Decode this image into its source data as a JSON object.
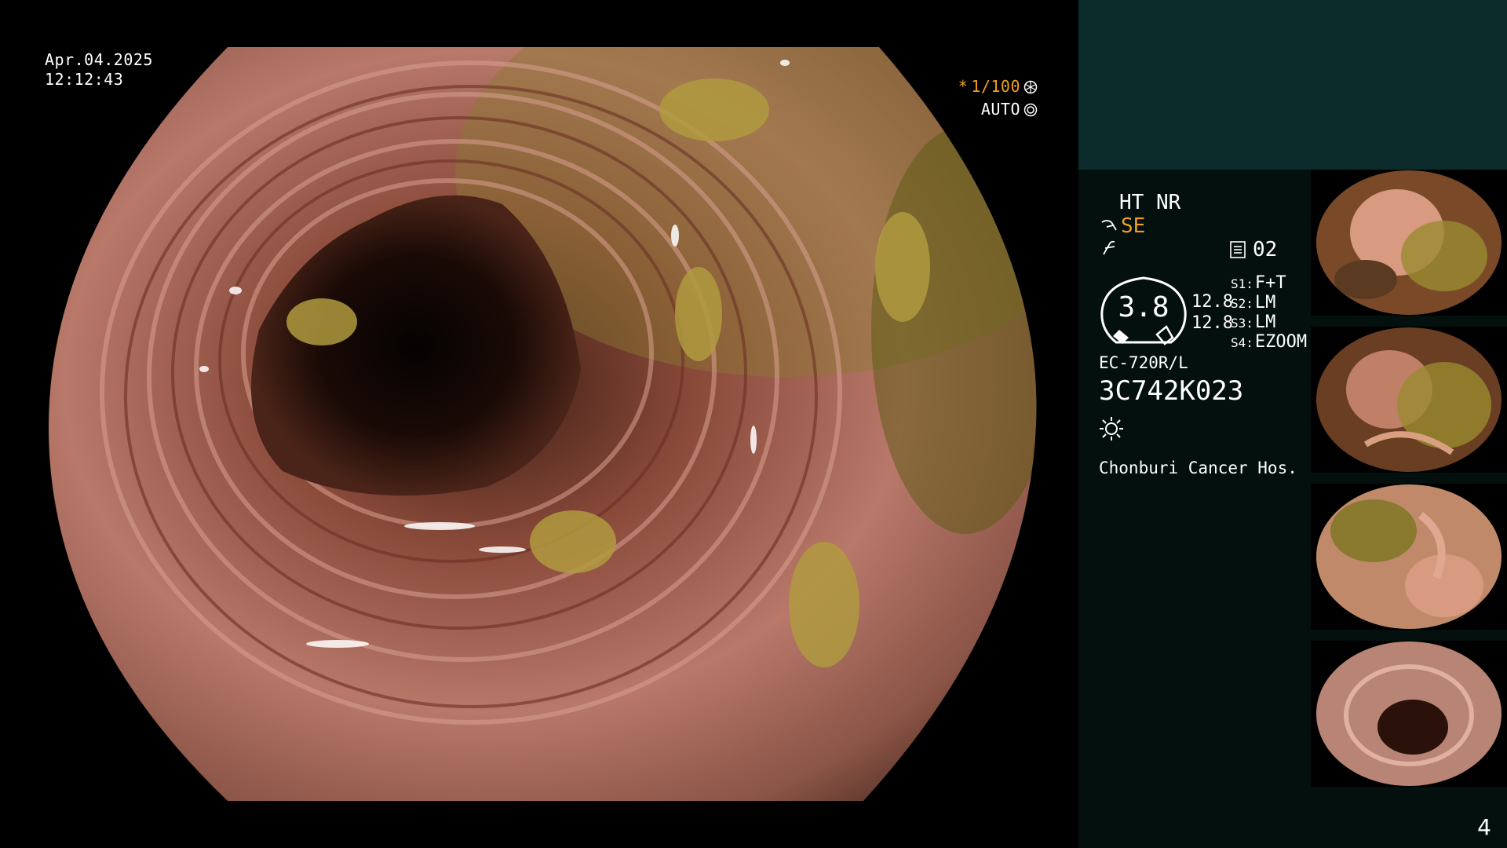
{
  "overlay": {
    "date": "Apr.04.2025",
    "time": "12:12:43",
    "shutter_prefix": "*",
    "shutter_value": "1/100",
    "iris_mode": "AUTO",
    "accent_color": "#f0a020"
  },
  "panel": {
    "enhancement": "HT NR",
    "structure_mode": "SE",
    "memo_count": "02",
    "dial_value": "3.8",
    "level_1": "12.8",
    "level_2": "12.8",
    "switches": [
      {
        "key": "S1:",
        "value": "F+T"
      },
      {
        "key": "S2:",
        "value": "LM"
      },
      {
        "key": "S3:",
        "value": "LM"
      },
      {
        "key": "S4:",
        "value": "EZOOM"
      }
    ],
    "scope_model": "EC-720R/L",
    "scope_serial": "3C742K023",
    "hospital": "Chonburi Cancer Hos."
  },
  "icons": [
    "shutter-icon",
    "iris-icon",
    "structure-icon",
    "hook-icon",
    "memo-icon",
    "light-sun-icon"
  ],
  "page_number": "4"
}
